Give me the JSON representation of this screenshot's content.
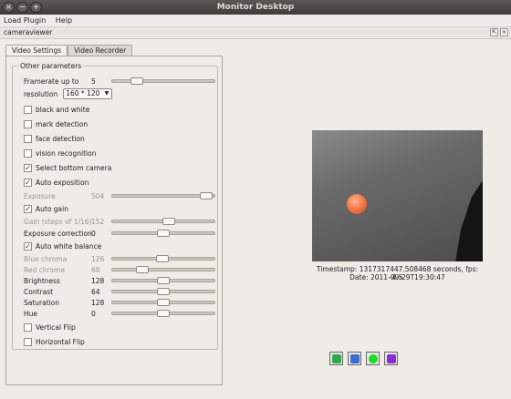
{
  "window": {
    "title": "Monitor Desktop",
    "controls": [
      "×",
      "−",
      "+"
    ]
  },
  "menu": [
    "Load Plugin",
    "Help"
  ],
  "plugin": {
    "title": "cameraviewer",
    "btns": [
      "⇱",
      "×"
    ]
  },
  "tabs": [
    "Video Settings",
    "Video Recorder"
  ],
  "group_title": "Other parameters",
  "settings": {
    "framerate_label": "Framerate up to",
    "framerate_value": "5",
    "framerate_fraction": 0.2,
    "resolution_label": "resolution",
    "resolution_value": "160 * 120",
    "checks": [
      {
        "label": "black and white",
        "checked": false
      },
      {
        "label": "mark detection",
        "checked": false
      },
      {
        "label": "face detection",
        "checked": false
      },
      {
        "label": "vision recognition",
        "checked": false
      },
      {
        "label": "Select bottom camera",
        "checked": true
      },
      {
        "label": "Auto exposition",
        "checked": true
      }
    ],
    "exposure": {
      "label": "Exposure",
      "value": "504",
      "fraction": 0.98
    },
    "auto_gain": {
      "label": "Auto gain",
      "checked": true
    },
    "gain": {
      "label": "Gain (steps of 1/16)",
      "value": "152",
      "fraction": 0.56
    },
    "exposure_correction": {
      "label": "Exposure correction",
      "value": "0",
      "fraction": 0.5
    },
    "auto_white": {
      "label": "Auto white balance",
      "checked": true
    },
    "blue": {
      "label": "Blue chroma",
      "value": "126",
      "fraction": 0.49
    },
    "red": {
      "label": "Red chroma",
      "value": "68",
      "fraction": 0.27
    },
    "brightness": {
      "label": "Brightness",
      "value": "128",
      "fraction": 0.5
    },
    "contrast": {
      "label": "Contrast",
      "value": "64",
      "fraction": 0.5
    },
    "saturation": {
      "label": "Saturation",
      "value": "128",
      "fraction": 0.5
    },
    "hue": {
      "label": "Hue",
      "value": "0",
      "fraction": 0.5
    },
    "vflip": {
      "label": "Vertical Flip",
      "checked": false
    },
    "hflip": {
      "label": "Horizontal Flip",
      "checked": false
    }
  },
  "stream": {
    "timestamp": "Timestamp: 1317317447.508468 seconds,  fps: 4.5",
    "date": "Date: 2011-09-29T19:30:47"
  },
  "playback": [
    {
      "name": "play-button",
      "color": "#2fa84a",
      "icon": "play-icon"
    },
    {
      "name": "pause-button",
      "color": "#3a6bd1",
      "icon": "pause-icon"
    },
    {
      "name": "record-button",
      "color": "#1bdc1b",
      "icon": "record-icon"
    },
    {
      "name": "stop-button",
      "color": "#8a2bd6",
      "icon": "stop-icon"
    }
  ]
}
